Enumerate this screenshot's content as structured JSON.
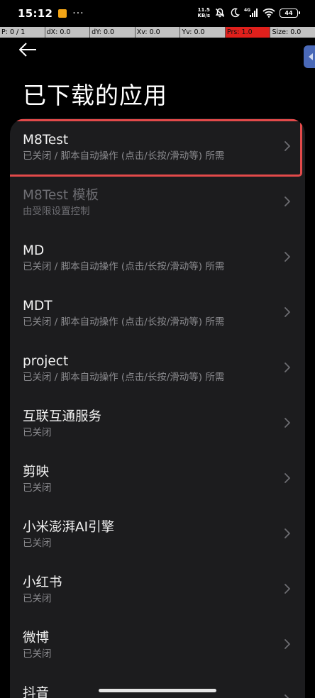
{
  "status_bar": {
    "time": "15:12",
    "more": "···",
    "net_speed_value": "11.5",
    "net_speed_unit": "KB/s",
    "network_type": "4G",
    "battery": "44"
  },
  "pointer_info": {
    "p": "P: 0 / 1",
    "dx": "dX: 0.0",
    "dy": "dY: 0.0",
    "xv": "Xv: 0.0",
    "yv": "Yv: 0.0",
    "prs": "Prs: 1.0",
    "size": "Size: 0.0"
  },
  "page": {
    "title": "已下载的应用"
  },
  "apps": [
    {
      "name": "M8Test",
      "status": "已关闭 / 脚本自动操作 (点击/长按/滑动等) 所需",
      "enabled": true,
      "highlighted": true
    },
    {
      "name": "M8Test 模板",
      "status": "由受限设置控制",
      "enabled": false,
      "highlighted": false
    },
    {
      "name": "MD",
      "status": "已关闭 / 脚本自动操作 (点击/长按/滑动等) 所需",
      "enabled": true,
      "highlighted": false
    },
    {
      "name": "MDT",
      "status": "已关闭 / 脚本自动操作 (点击/长按/滑动等) 所需",
      "enabled": true,
      "highlighted": false
    },
    {
      "name": "project",
      "status": "已关闭 / 脚本自动操作 (点击/长按/滑动等) 所需",
      "enabled": true,
      "highlighted": false
    },
    {
      "name": "互联互通服务",
      "status": "已关闭",
      "enabled": true,
      "highlighted": false
    },
    {
      "name": "剪映",
      "status": "已关闭",
      "enabled": true,
      "highlighted": false
    },
    {
      "name": "小米澎湃AI引擎",
      "status": "已关闭",
      "enabled": true,
      "highlighted": false
    },
    {
      "name": "小红书",
      "status": "已关闭",
      "enabled": true,
      "highlighted": false
    },
    {
      "name": "微博",
      "status": "已关闭",
      "enabled": true,
      "highlighted": false
    },
    {
      "name": "抖音",
      "status": "",
      "enabled": true,
      "highlighted": false
    }
  ],
  "colors": {
    "background": "#000000",
    "card": "#1c1c1e",
    "highlight_border": "#e24a4a",
    "pressure_cell": "#e0201c",
    "side_handle": "#4a69b8"
  }
}
